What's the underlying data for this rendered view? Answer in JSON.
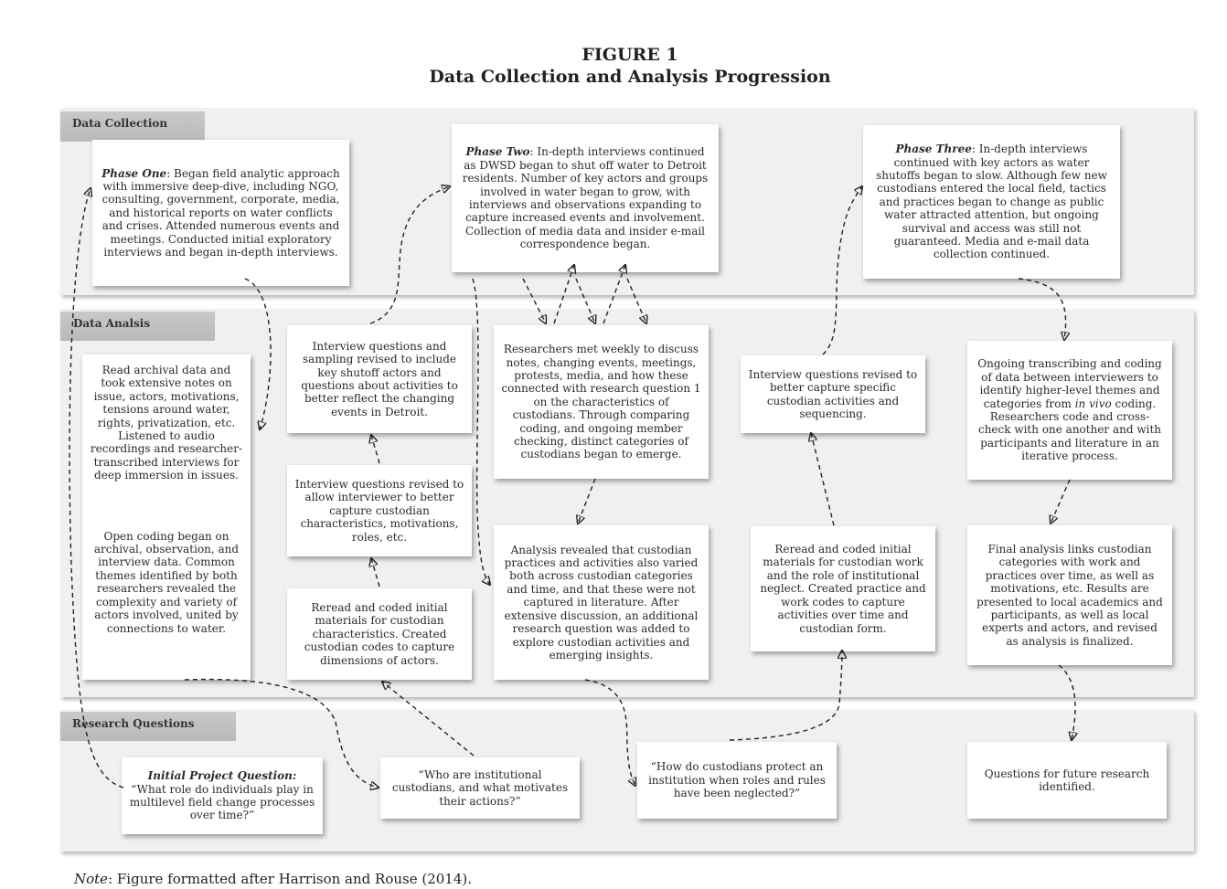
{
  "figure": {
    "label": "FIGURE 1",
    "title": "Data Collection and Analysis Progression"
  },
  "bands": {
    "collection": "Data Collection",
    "analysis": "Data Analsis",
    "questions": "Research Questions"
  },
  "collection": {
    "phase_one": {
      "lead": "Phase One",
      "text": ": Began field analytic approach with immersive deep-dive, including NGO, consulting, government, corporate, media, and historical reports on water conflicts and crises. Attended numerous events and meetings. Conducted initial exploratory interviews and began in-depth interviews."
    },
    "phase_two": {
      "lead": "Phase Two",
      "text": ": In-depth interviews continued as DWSD began to shut off water to Detroit residents. Number of key actors and groups involved in water began to grow, with interviews and observations expanding to capture increased events and involvement. Collection of media data and insider e-mail correspondence began."
    },
    "phase_three": {
      "lead": "Phase Three",
      "text": ": In-depth interviews continued with key actors as water shutoffs began to slow. Although few new custodians entered the local field, tactics and practices began to change as public water attracted attention, but ongoing survival and access was still not guaranteed. Media and e-mail data collection continued."
    }
  },
  "analysis": {
    "archival_read": "Read archival data and took extensive notes on issue, actors, motivations, tensions around water, rights, privatization, etc. Listened to audio recordings and researcher-transcribed interviews for deep immersion in issues.",
    "open_coding": "Open coding began on archival, observation, and interview data. Common themes identified by both researchers revealed the complexity and variety of actors involved, united by connections to water.",
    "questions_revised_shutoff": "Interview questions and sampling revised to include key shutoff actors and questions about activities to better reflect the changing events in Detroit.",
    "questions_revised_characteristics": "Interview questions revised to allow interviewer to better capture custodian characteristics, motivations, roles, etc.",
    "reread_characteristics": "Reread and coded initial materials for custodian characteristics. Created custodian codes to capture dimensions of actors.",
    "weekly_meetings": "Researchers met weekly to discuss notes, changing events, meetings, protests, media, and how these connected with research question 1 on the characteristics of custodians. Through comparing coding, and ongoing member checking, distinct categories of custodians began to emerge.",
    "analysis_revealed": "Analysis revealed that custodian practices and activities also varied both across custodian categories and time, and that these were not captured in literature. After extensive discussion, an additional research question was added to explore custodian activities and emerging insights.",
    "questions_revised_sequencing": "Interview questions revised to better capture specific custodian activities and sequencing.",
    "reread_work": "Reread and coded initial materials for custodian work and the role of institutional neglect. Created practice and work codes to capture activities over time and custodian form.",
    "ongoing_transcribing_a": "Ongoing transcribing and coding of data between interviewers to identify higher-level themes and categories from ",
    "ongoing_transcribing_em": "in vivo",
    "ongoing_transcribing_b": " coding. Researchers code and cross-check with one another and with participants and literature in an iterative process.",
    "final_analysis": "Final analysis links custodian categories with work and practices over time, as well as motivations, etc. Results are presented to local academics and participants, as well as local experts and actors, and revised as analysis is finalized."
  },
  "questions": {
    "initial_lead": "Initial Project Question:",
    "initial_text": "“What role do individuals play in multilevel field change processes over time?”",
    "who": "“Who are institutional custodians, and what motivates their actions?”",
    "how": "“How do custodians protect an institution when roles and rules have been neglected?”",
    "future": "Questions for future research identified."
  },
  "note": {
    "label": "Note",
    "text": ": Figure formatted after Harrison and Rouse (2014)."
  }
}
